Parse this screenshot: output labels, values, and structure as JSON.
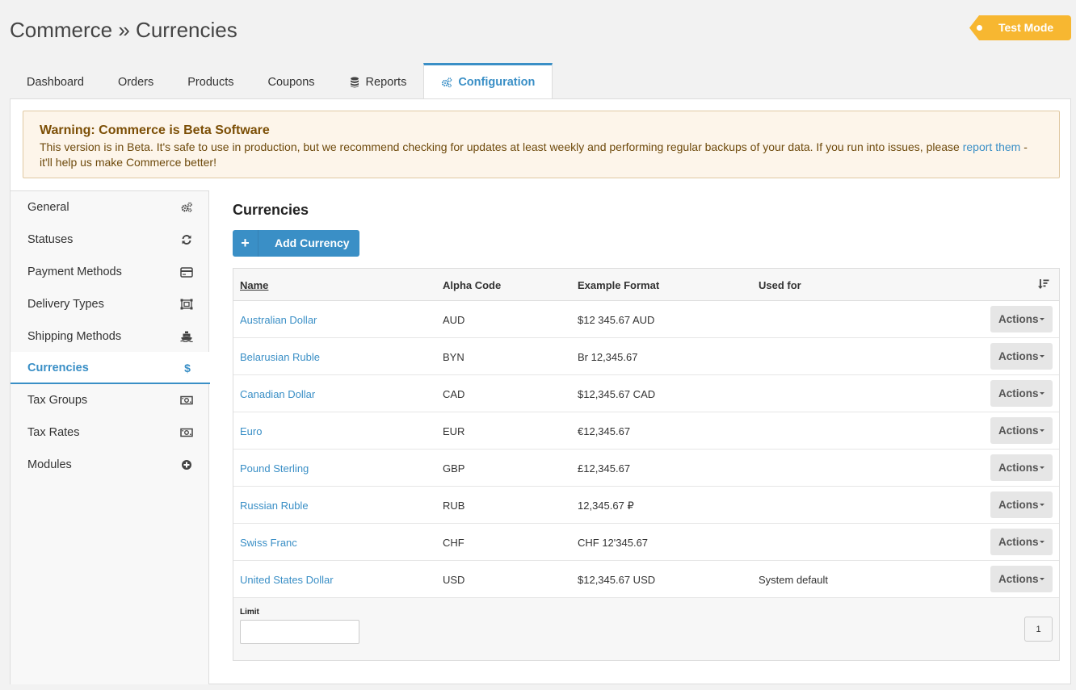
{
  "header": {
    "title": "Commerce » Currencies",
    "test_mode_label": "Test Mode",
    "test_mode_color": "#f7b731"
  },
  "tabs": [
    {
      "label": "Dashboard"
    },
    {
      "label": "Orders"
    },
    {
      "label": "Products"
    },
    {
      "label": "Coupons"
    },
    {
      "label": "Reports",
      "icon": "database-icon"
    },
    {
      "label": "Configuration",
      "icon": "cogs-icon",
      "active": true
    }
  ],
  "warning": {
    "title": "Warning: Commerce is Beta Software",
    "body_before": "This version is in Beta. It's safe to use in production, but we recommend checking for updates at least weekly and performing regular backups of your data. If you run into issues, please ",
    "link": "report them",
    "body_after": " - it'll help us make Commerce better!"
  },
  "sidebar": {
    "items": [
      {
        "label": "General",
        "icon": "cogs-icon"
      },
      {
        "label": "Statuses",
        "icon": "refresh-icon"
      },
      {
        "label": "Payment Methods",
        "icon": "credit-card-icon"
      },
      {
        "label": "Delivery Types",
        "icon": "object-group-icon"
      },
      {
        "label": "Shipping Methods",
        "icon": "ship-icon"
      },
      {
        "label": "Currencies",
        "icon": "dollar-icon",
        "active": true
      },
      {
        "label": "Tax Groups",
        "icon": "money-icon"
      },
      {
        "label": "Tax Rates",
        "icon": "money-icon"
      },
      {
        "label": "Modules",
        "icon": "plus-circle-icon"
      }
    ]
  },
  "main": {
    "title": "Currencies",
    "add_button": "Add Currency",
    "accent_color": "#3a8fc6"
  },
  "table": {
    "columns": [
      "Name",
      "Alpha Code",
      "Example Format",
      "Used for"
    ],
    "actions_label": "Actions",
    "rows": [
      {
        "name": "Australian Dollar",
        "code": "AUD",
        "format": "$12 345.67 AUD",
        "used_for": ""
      },
      {
        "name": "Belarusian Ruble",
        "code": "BYN",
        "format": "Br 12,345.67",
        "used_for": ""
      },
      {
        "name": "Canadian Dollar",
        "code": "CAD",
        "format": "$12,345.67 CAD",
        "used_for": ""
      },
      {
        "name": "Euro",
        "code": "EUR",
        "format": "€12,345.67",
        "used_for": ""
      },
      {
        "name": "Pound Sterling",
        "code": "GBP",
        "format": "£12,345.67",
        "used_for": ""
      },
      {
        "name": "Russian Ruble",
        "code": "RUB",
        "format": "12,345.67 ₽",
        "used_for": ""
      },
      {
        "name": "Swiss Franc",
        "code": "CHF",
        "format": "CHF 12'345.67",
        "used_for": ""
      },
      {
        "name": "United States Dollar",
        "code": "USD",
        "format": "$12,345.67 USD",
        "used_for": "System default"
      }
    ],
    "limit_label": "Limit",
    "limit_value": "",
    "page": "1"
  }
}
